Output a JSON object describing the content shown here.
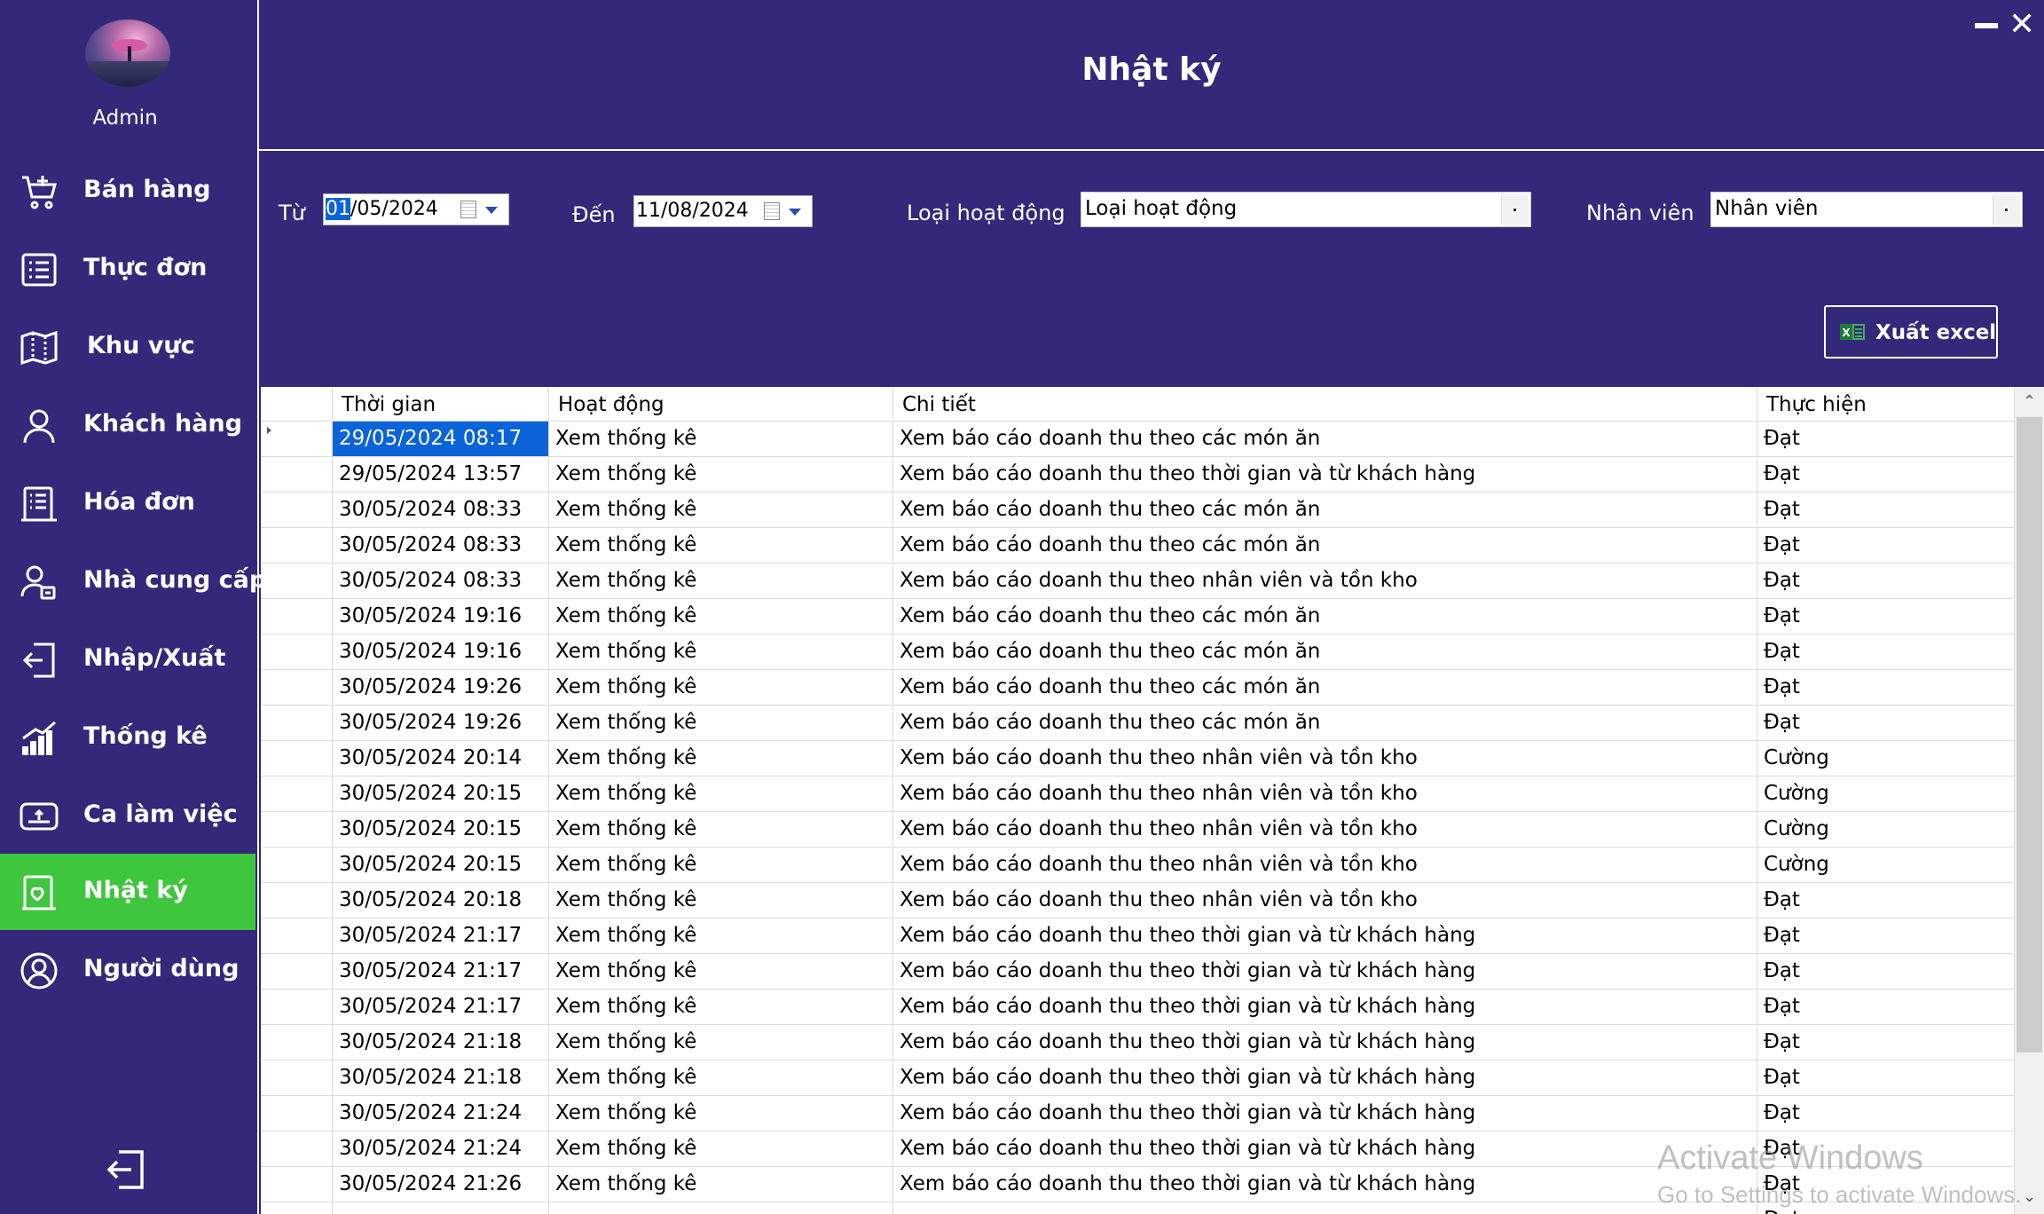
{
  "app": {
    "user_label": "Admin",
    "page_title": "Nhật ký"
  },
  "sidebar": {
    "items": [
      {
        "label": "Bán hàng",
        "icon": "cart-icon"
      },
      {
        "label": "Thực đơn",
        "icon": "menu-list-icon"
      },
      {
        "label": "Khu vực",
        "icon": "map-icon"
      },
      {
        "label": "Khách hàng",
        "icon": "person-icon"
      },
      {
        "label": "Hóa đơn",
        "icon": "invoice-icon"
      },
      {
        "label": "Nhà cung cấp",
        "icon": "supplier-icon"
      },
      {
        "label": "Nhập/Xuất",
        "icon": "import-export-icon"
      },
      {
        "label": "Thống kê",
        "icon": "chart-icon"
      },
      {
        "label": "Ca làm việc",
        "icon": "shift-icon"
      },
      {
        "label": "Nhật ký",
        "icon": "journal-icon",
        "active": true
      },
      {
        "label": "Người dùng",
        "icon": "user-circle-icon"
      }
    ],
    "active_color": "#3ec63e",
    "background": "#34287a"
  },
  "filters": {
    "from_label": "Từ",
    "from_value_selected": "01",
    "from_value_rest": "/05/2024",
    "to_label": "Đến",
    "to_value": "11/08/2024",
    "activity_type_label": "Loại hoạt động",
    "activity_type_value": "Loại hoạt động",
    "employee_label": "Nhân viên",
    "employee_value": "Nhân viên"
  },
  "export_button": "Xuất excel",
  "table": {
    "columns": [
      "Thời gian",
      "Hoạt động",
      "Chi tiết",
      "Thực hiện"
    ],
    "rows": [
      [
        "29/05/2024 08:17",
        "Xem thống kê",
        "Xem báo cáo doanh thu theo các món ăn",
        "Đạt"
      ],
      [
        "29/05/2024 13:57",
        "Xem thống kê",
        "Xem báo cáo doanh thu theo thời gian và từ khách hàng",
        "Đạt"
      ],
      [
        "30/05/2024 08:33",
        "Xem thống kê",
        "Xem báo cáo doanh thu theo các món ăn",
        "Đạt"
      ],
      [
        "30/05/2024 08:33",
        "Xem thống kê",
        "Xem báo cáo doanh thu theo các món ăn",
        "Đạt"
      ],
      [
        "30/05/2024 08:33",
        "Xem thống kê",
        "Xem báo cáo doanh thu theo nhân viên và tồn kho",
        "Đạt"
      ],
      [
        "30/05/2024 19:16",
        "Xem thống kê",
        "Xem báo cáo doanh thu theo các món ăn",
        "Đạt"
      ],
      [
        "30/05/2024 19:16",
        "Xem thống kê",
        "Xem báo cáo doanh thu theo các món ăn",
        "Đạt"
      ],
      [
        "30/05/2024 19:26",
        "Xem thống kê",
        "Xem báo cáo doanh thu theo các món ăn",
        "Đạt"
      ],
      [
        "30/05/2024 19:26",
        "Xem thống kê",
        "Xem báo cáo doanh thu theo các món ăn",
        "Đạt"
      ],
      [
        "30/05/2024 20:14",
        "Xem thống kê",
        "Xem báo cáo doanh thu theo nhân viên và tồn kho",
        "Cường"
      ],
      [
        "30/05/2024 20:15",
        "Xem thống kê",
        "Xem báo cáo doanh thu theo nhân viên và tồn kho",
        "Cường"
      ],
      [
        "30/05/2024 20:15",
        "Xem thống kê",
        "Xem báo cáo doanh thu theo nhân viên và tồn kho",
        "Cường"
      ],
      [
        "30/05/2024 20:15",
        "Xem thống kê",
        "Xem báo cáo doanh thu theo nhân viên và tồn kho",
        "Cường"
      ],
      [
        "30/05/2024 20:18",
        "Xem thống kê",
        "Xem báo cáo doanh thu theo nhân viên và tồn kho",
        "Đạt"
      ],
      [
        "30/05/2024 21:17",
        "Xem thống kê",
        "Xem báo cáo doanh thu theo thời gian và từ khách hàng",
        "Đạt"
      ],
      [
        "30/05/2024 21:17",
        "Xem thống kê",
        "Xem báo cáo doanh thu theo thời gian và từ khách hàng",
        "Đạt"
      ],
      [
        "30/05/2024 21:17",
        "Xem thống kê",
        "Xem báo cáo doanh thu theo thời gian và từ khách hàng",
        "Đạt"
      ],
      [
        "30/05/2024 21:18",
        "Xem thống kê",
        "Xem báo cáo doanh thu theo thời gian và từ khách hàng",
        "Đạt"
      ],
      [
        "30/05/2024 21:18",
        "Xem thống kê",
        "Xem báo cáo doanh thu theo thời gian và từ khách hàng",
        "Đạt"
      ],
      [
        "30/05/2024 21:24",
        "Xem thống kê",
        "Xem báo cáo doanh thu theo thời gian và từ khách hàng",
        "Đạt"
      ],
      [
        "30/05/2024 21:24",
        "Xem thống kê",
        "Xem báo cáo doanh thu theo thời gian và từ khách hàng",
        "Đạt"
      ],
      [
        "30/05/2024 21:26",
        "Xem thống kê",
        "Xem báo cáo doanh thu theo thời gian và từ khách hàng",
        "Đạt"
      ],
      [
        "",
        "",
        "",
        "Đạt"
      ]
    ],
    "selected_row": 0
  },
  "watermark": {
    "line1": "Activate Windows",
    "line2": "Go to Settings to activate Windows."
  }
}
